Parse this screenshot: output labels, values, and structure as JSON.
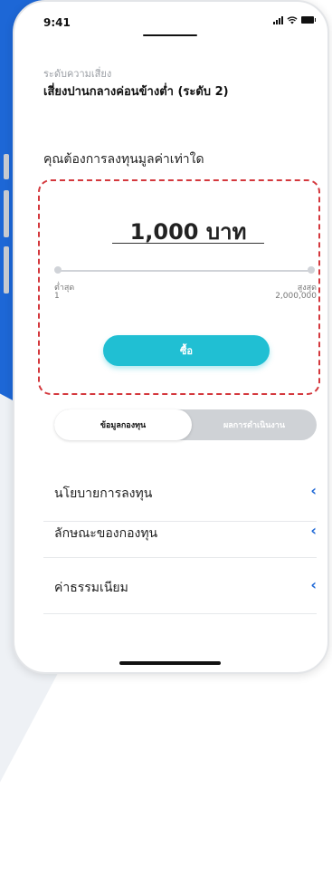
{
  "status_bar": {
    "time": "9:41"
  },
  "risk": {
    "caption": "ระดับความเสี่ยง",
    "title": "เสี่ยงปานกลางค่อนข้างต่ำ (ระดับ 2)"
  },
  "invest": {
    "question": "คุณต้องการลงทุนมูลค่าเท่าใด",
    "amount": "1,000  บาท",
    "min_label": "ต่ำสุด",
    "min_value": "1",
    "max_label": "สูงสุด",
    "max_value": "2,000,000",
    "buy_label": "ซื้อ"
  },
  "tabs": {
    "active": "ข้อมูลกองทุน",
    "inactive": "ผลการดำเนินงาน"
  },
  "rows": [
    {
      "label": "นโยบายการลงทุน"
    },
    {
      "label": "ลักษณะของกองทุน"
    },
    {
      "label": "ค่าธรรมเนียม"
    }
  ],
  "icons": {
    "row_chevron": "chevron-left-icon",
    "signal": "signal-icon",
    "wifi": "wifi-icon",
    "battery": "battery-icon"
  },
  "colors": {
    "accent": "#20bfd3",
    "brand_blue": "#1d67d6",
    "highlight_border": "#d4383d"
  }
}
